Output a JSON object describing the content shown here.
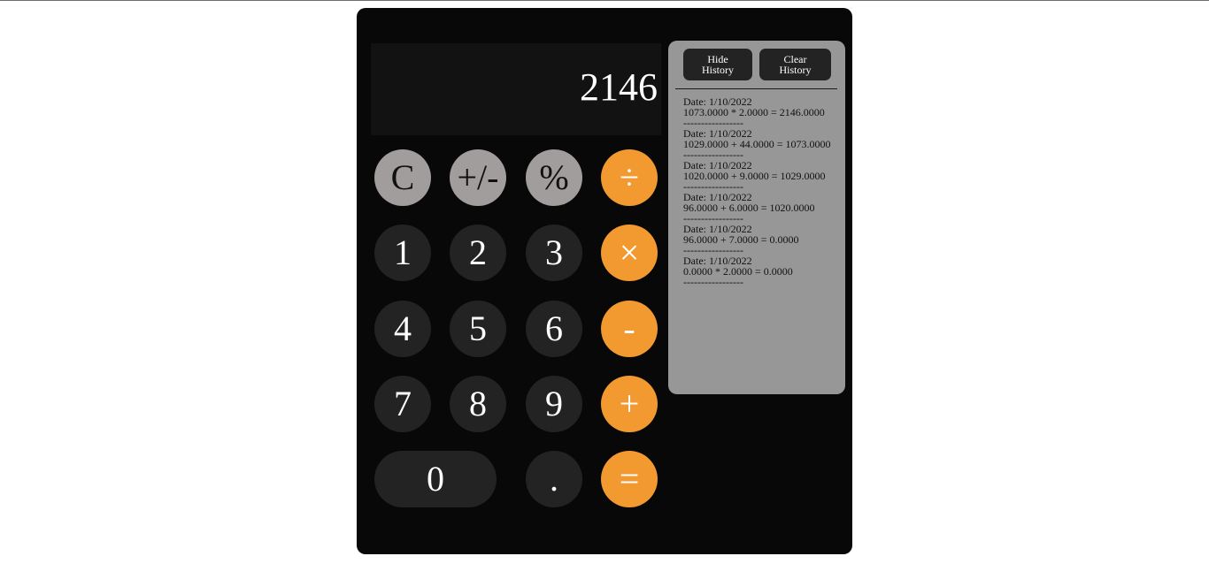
{
  "display": {
    "value": "2146"
  },
  "keypad": {
    "row1": [
      "C",
      "+/-",
      "%",
      "÷"
    ],
    "row2": [
      "1",
      "2",
      "3",
      "×"
    ],
    "row3": [
      "4",
      "5",
      "6",
      "-"
    ],
    "row4": [
      "7",
      "8",
      "9",
      "+"
    ],
    "row5": [
      "0",
      ".",
      "="
    ]
  },
  "history": {
    "hide_label_line1": "Hide",
    "hide_label_line2": "History",
    "clear_label_line1": "Clear",
    "clear_label_line2": "History",
    "separator": "-----------------",
    "entries": [
      {
        "date": "Date: 1/10/2022",
        "expr": "1073.0000 * 2.0000 = 2146.0000"
      },
      {
        "date": "Date: 1/10/2022",
        "expr": "1029.0000 + 44.0000 = 1073.0000"
      },
      {
        "date": "Date: 1/10/2022",
        "expr": "1020.0000 + 9.0000 = 1029.0000"
      },
      {
        "date": "Date: 1/10/2022",
        "expr": "96.0000 + 6.0000 = 1020.0000"
      },
      {
        "date": "Date: 1/10/2022",
        "expr": "96.0000 + 7.0000 = 0.0000"
      },
      {
        "date": "Date: 1/10/2022",
        "expr": "0.0000 * 2.0000 = 0.0000"
      }
    ]
  },
  "colors": {
    "background": "#ffffff",
    "calculator_body": "#080808",
    "display_bg": "#121212",
    "function_key": "#a29d9d",
    "number_key": "#232323",
    "operator_key": "#f29a30",
    "history_panel": "#979797"
  }
}
